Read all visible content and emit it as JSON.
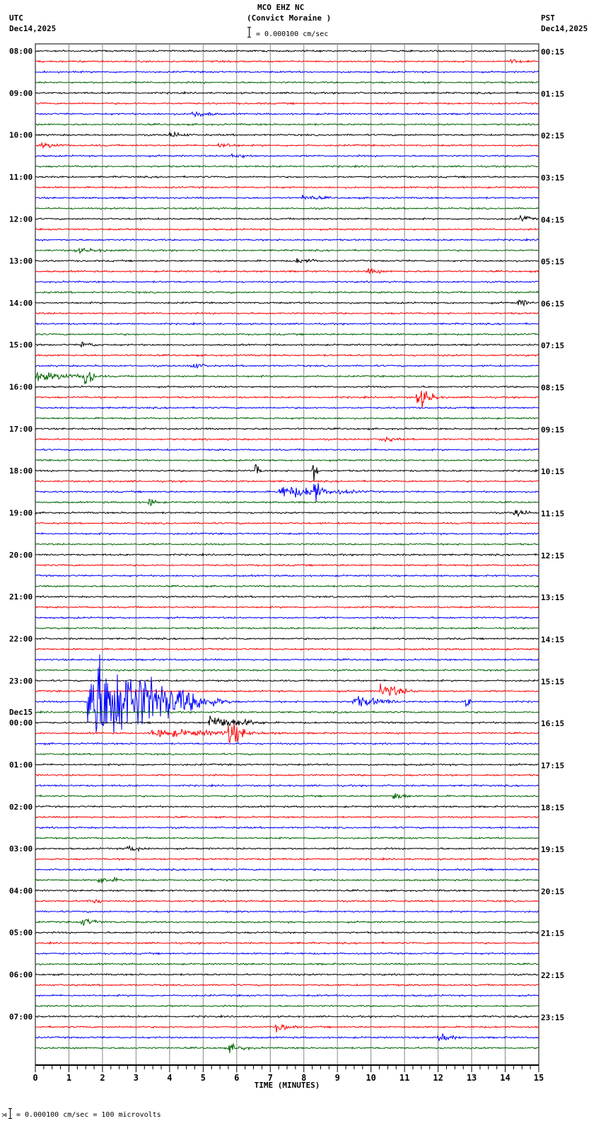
{
  "header": {
    "station": "MCO EHZ NC",
    "site": "(Convict Moraine )",
    "left_tz": "UTC",
    "left_date": "Dec14,2025",
    "right_tz": "PST",
    "right_date": "Dec14,2025",
    "scale": "= 0.000100 cm/sec"
  },
  "footer": {
    "scale_note": "= 0.000100 cm/sec =     100 microvolts",
    "mark": "⋊"
  },
  "chart_data": {
    "type": "line",
    "title": "MCO EHZ NC (Convict Moraine )",
    "xlabel": "TIME (MINUTES)",
    "xlim": [
      0,
      15
    ],
    "x_ticks": [
      "0",
      "1",
      "2",
      "3",
      "4",
      "5",
      "6",
      "7",
      "8",
      "9",
      "10",
      "11",
      "12",
      "13",
      "14",
      "15"
    ],
    "traces_per_hour": 4,
    "trace_count": 96,
    "trace_colors": [
      "#000000",
      "#ff0000",
      "#0000ff",
      "#006400"
    ],
    "left_labels": [
      "08:00",
      "09:00",
      "10:00",
      "11:00",
      "12:00",
      "13:00",
      "14:00",
      "15:00",
      "16:00",
      "17:00",
      "18:00",
      "19:00",
      "20:00",
      "21:00",
      "22:00",
      "23:00",
      "00:00",
      "01:00",
      "02:00",
      "03:00",
      "04:00",
      "05:00",
      "06:00",
      "07:00"
    ],
    "day_change_label": "Dec15",
    "right_labels": [
      "00:15",
      "01:15",
      "02:15",
      "03:15",
      "04:15",
      "05:15",
      "06:15",
      "07:15",
      "08:15",
      "09:15",
      "10:15",
      "11:15",
      "12:15",
      "13:15",
      "14:15",
      "15:15",
      "16:15",
      "17:15",
      "18:15",
      "19:15",
      "20:15",
      "21:15",
      "22:15",
      "23:15"
    ],
    "events": [
      {
        "trace": 1,
        "minute": 14.2,
        "amp": 2,
        "dur": 0.6
      },
      {
        "trace": 6,
        "minute": 4.7,
        "amp": 4,
        "dur": 1.0
      },
      {
        "trace": 8,
        "minute": 4.0,
        "amp": 4,
        "dur": 0.8
      },
      {
        "trace": 9,
        "minute": 0.2,
        "amp": 3,
        "dur": 1.0
      },
      {
        "trace": 9,
        "minute": 5.5,
        "amp": 3,
        "dur": 0.8
      },
      {
        "trace": 10,
        "minute": 5.9,
        "amp": 3,
        "dur": 0.8
      },
      {
        "trace": 14,
        "minute": 8.0,
        "amp": 3,
        "dur": 1.0
      },
      {
        "trace": 16,
        "minute": 14.5,
        "amp": 4,
        "dur": 0.5
      },
      {
        "trace": 19,
        "minute": 1.2,
        "amp": 2.5,
        "dur": 1.5
      },
      {
        "trace": 20,
        "minute": 7.8,
        "amp": 3,
        "dur": 1.0
      },
      {
        "trace": 21,
        "minute": 9.9,
        "amp": 3,
        "dur": 0.8
      },
      {
        "trace": 24,
        "minute": 14.4,
        "amp": 5,
        "dur": 0.5
      },
      {
        "trace": 28,
        "minute": 1.4,
        "amp": 4,
        "dur": 0.6
      },
      {
        "trace": 30,
        "minute": 4.6,
        "amp": 4,
        "dur": 0.8
      },
      {
        "trace": 31,
        "minute": 0.0,
        "amp": 5,
        "dur": 2.5
      },
      {
        "trace": 31,
        "minute": 1.5,
        "amp": 18,
        "dur": 0.4
      },
      {
        "trace": 33,
        "minute": 11.4,
        "amp": 14,
        "dur": 0.8
      },
      {
        "trace": 37,
        "minute": 10.3,
        "amp": 3,
        "dur": 0.8
      },
      {
        "trace": 40,
        "minute": 6.6,
        "amp": 8,
        "dur": 0.2
      },
      {
        "trace": 40,
        "minute": 8.3,
        "amp": 14,
        "dur": 0.2
      },
      {
        "trace": 42,
        "minute": 7.3,
        "amp": 8,
        "dur": 3.0
      },
      {
        "trace": 42,
        "minute": 8.35,
        "amp": 20,
        "dur": 0.3
      },
      {
        "trace": 43,
        "minute": 3.4,
        "amp": 5,
        "dur": 0.5
      },
      {
        "trace": 44,
        "minute": 14.3,
        "amp": 5,
        "dur": 0.7
      },
      {
        "trace": 61,
        "minute": 10.3,
        "amp": 10,
        "dur": 1.2
      },
      {
        "trace": 62,
        "minute": 1.6,
        "amp": 70,
        "dur": 4.5
      },
      {
        "trace": 62,
        "minute": 9.5,
        "amp": 7,
        "dur": 1.8
      },
      {
        "trace": 62,
        "minute": 12.85,
        "amp": 8,
        "dur": 0.2
      },
      {
        "trace": 64,
        "minute": 5.2,
        "amp": 10,
        "dur": 2.0
      },
      {
        "trace": 65,
        "minute": 3.5,
        "amp": 5,
        "dur": 4.5
      },
      {
        "trace": 65,
        "minute": 5.8,
        "amp": 16,
        "dur": 0.8
      },
      {
        "trace": 71,
        "minute": 10.7,
        "amp": 6,
        "dur": 0.6
      },
      {
        "trace": 76,
        "minute": 2.7,
        "amp": 4,
        "dur": 1.0
      },
      {
        "trace": 79,
        "minute": 1.9,
        "amp": 4,
        "dur": 1.0
      },
      {
        "trace": 81,
        "minute": 1.6,
        "amp": 4,
        "dur": 0.6
      },
      {
        "trace": 83,
        "minute": 1.4,
        "amp": 5,
        "dur": 0.8
      },
      {
        "trace": 93,
        "minute": 7.2,
        "amp": 5,
        "dur": 0.8
      },
      {
        "trace": 94,
        "minute": 12.0,
        "amp": 6,
        "dur": 0.8
      },
      {
        "trace": 95,
        "minute": 5.8,
        "amp": 5,
        "dur": 0.8
      }
    ]
  }
}
